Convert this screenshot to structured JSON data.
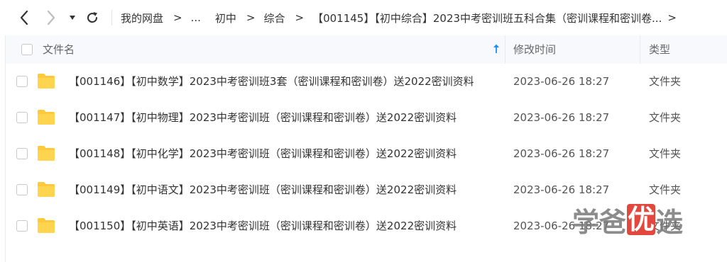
{
  "toolbar": {
    "icons": [
      "back-arrow-icon",
      "forward-arrow-icon",
      "dropdown-caret-icon",
      "refresh-icon"
    ]
  },
  "breadcrumb": {
    "items": [
      {
        "label": "我的网盘"
      },
      {
        "label": "..."
      },
      {
        "label": "初中"
      },
      {
        "label": "综合"
      },
      {
        "label": "【001145】【初中综合】2023中考密训班五科合集（密训课程和密训卷..."
      }
    ]
  },
  "table": {
    "columns": {
      "name": "文件名",
      "modified": "修改时间",
      "type": "类型"
    },
    "sort": "ascending",
    "rows": [
      {
        "name": "【001146】【初中数学】2023中考密训班3套（密训课程和密训卷）送2022密训资料",
        "modified": "2023-06-26 18:27",
        "type": "文件夹"
      },
      {
        "name": "【001147】【初中物理】2023中考密训班（密训课程和密训卷）送2022密训资料",
        "modified": "2023-06-26 18:27",
        "type": "文件夹"
      },
      {
        "name": "【001148】【初中化学】2023中考密训班（密训课程和密训卷）送2022密训资料",
        "modified": "2023-06-26 18:27",
        "type": "文件夹"
      },
      {
        "name": "【001149】【初中语文】2023中考密训班（密训课程和密训卷）送2022密训资料",
        "modified": "2023-06-26 18:27",
        "type": "文件夹"
      },
      {
        "name": "【001150】【初中英语】2023中考密训班（密训课程和密训卷）送2022密训资料",
        "modified": "2023-06-26 18:27",
        "type": "文件夹"
      }
    ]
  },
  "watermark": {
    "text_1": "学",
    "text_2": "爸",
    "text_3": "优",
    "text_4": "选",
    "highlight_color": "#e2483d"
  },
  "colors": {
    "folder": "#ffc93a",
    "header_bg": "#f7f9fc",
    "sort_arrow": "#1f8cff"
  }
}
